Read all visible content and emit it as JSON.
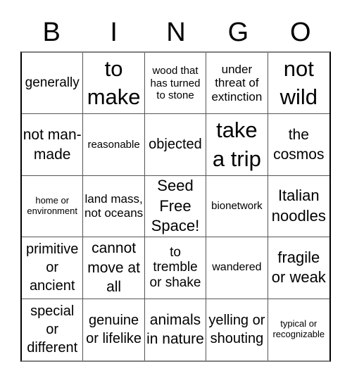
{
  "header": {
    "letters": [
      "B",
      "I",
      "N",
      "G",
      "O"
    ]
  },
  "card": {
    "free_space_label": "Seed Free Space!",
    "cells": [
      [
        "generally",
        "to make",
        "wood that has turned to stone",
        "under threat of extinction",
        "not wild"
      ],
      [
        "not man-made",
        "reasonable",
        "objected",
        "take a trip",
        "the cosmos"
      ],
      [
        "home or environment",
        "land mass, not oceans",
        "Seed Free Space!",
        "bionetwork",
        "Italian noodles"
      ],
      [
        "primitive or ancient",
        "cannot move at all",
        "to tremble or shake",
        "wandered",
        "fragile or weak"
      ],
      [
        "special or different",
        "genuine or lifelike",
        "animals in nature",
        "yelling or shouting",
        "typical or recognizable"
      ]
    ]
  }
}
